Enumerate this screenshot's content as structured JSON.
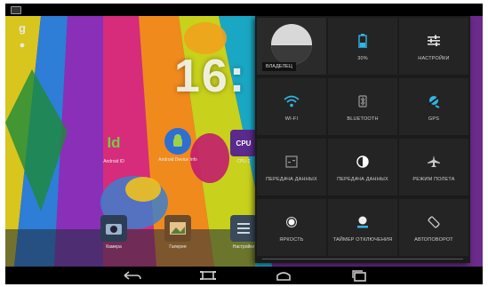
{
  "home": {
    "clock_text": "16:",
    "apps": [
      {
        "label": "Android ID",
        "icon_text": "Id"
      },
      {
        "label": "Android Device Info",
        "icon_text": ""
      },
      {
        "label": "CPU-Z",
        "icon_text": "CPU"
      },
      {
        "label": "Камера",
        "icon_text": ""
      },
      {
        "label": "Галерея",
        "icon_text": ""
      },
      {
        "label": "Настройки",
        "icon_text": ""
      }
    ]
  },
  "quick_settings": {
    "owner": "ВЛАДЕЛЕЦ",
    "tiles": [
      {
        "label": "30%",
        "icon": "battery-icon"
      },
      {
        "label": "НАСТРОЙКИ",
        "icon": "settings-sliders-icon"
      },
      {
        "label": "WI-FI",
        "icon": "wifi-icon"
      },
      {
        "label": "BLUETOOTH",
        "icon": "bluetooth-icon"
      },
      {
        "label": "GPS",
        "icon": "location-icon"
      },
      {
        "label": "ПЕРЕДАЧА ДАННЫХ",
        "icon": "mobile-data-icon"
      },
      {
        "label": "ПЕРЕДАЧА ДАННЫХ",
        "icon": "data-roaming-icon"
      },
      {
        "label": "РЕЖИМ ПОЛЕТА",
        "icon": "airplane-icon"
      },
      {
        "label": "ЯРКОСТЬ",
        "icon": "brightness-icon"
      },
      {
        "label": "ТАЙМЕР ОТКЛЮЧЕНИЯ",
        "icon": "sleep-timer-icon"
      },
      {
        "label": "АВТОПОВОРОТ",
        "icon": "auto-rotate-icon"
      }
    ]
  },
  "colors": {
    "accent_blue": "#33b5e5",
    "panel_bg": "#1b1b1b",
    "tile_bg": "#242424"
  }
}
